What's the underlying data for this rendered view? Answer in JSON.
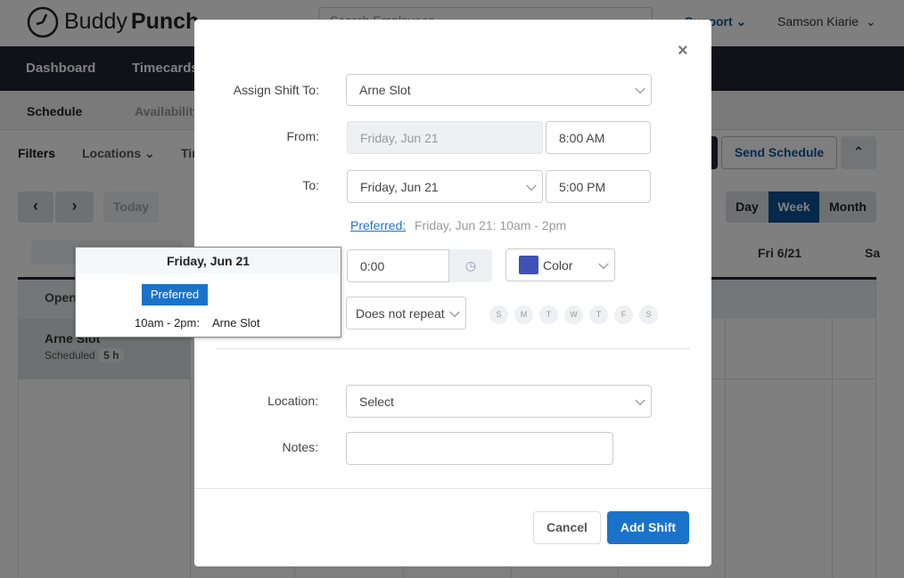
{
  "header": {
    "brand_light": "Buddy",
    "brand_bold": "Punch",
    "search_placeholder": "Search Employees",
    "support": "Support",
    "user": "Samson Kiarie"
  },
  "nav": {
    "items": [
      "Dashboard",
      "Timecards"
    ]
  },
  "subnav": {
    "items": [
      "Schedule",
      "Availability"
    ]
  },
  "toolbar": {
    "filters": "Filters",
    "locations": "Locations",
    "times": "Times",
    "send_schedule": "Send Schedule",
    "today": "Today",
    "views": [
      "Day",
      "Week",
      "Month"
    ],
    "active_view": "Week"
  },
  "calendar": {
    "day_headers": [
      "Fri 6/21",
      "Sa"
    ],
    "open_shifts": "Open Shifts",
    "employee": "Arne Slot",
    "scheduled_label": "Scheduled",
    "scheduled_hours": "5 h"
  },
  "tooltip": {
    "date": "Friday, Jun 21",
    "badge": "Preferred",
    "time": "10am - 2pm:",
    "name": "Arne Slot"
  },
  "modal": {
    "assign_label": "Assign Shift To:",
    "assign_value": "Arne Slot",
    "from_label": "From:",
    "from_date": "Friday, Jun 21",
    "from_time": "8:00 AM",
    "to_label": "To:",
    "to_date": "Friday, Jun 21",
    "to_time": "5:00 PM",
    "preferred_link": "Preferred:",
    "preferred_text": "Friday, Jun 21: 10am - 2pm",
    "break_value": "0:00",
    "color_label": "Color",
    "color": "#3f51b5",
    "repeat_value": "Does not repeat",
    "days": [
      "S",
      "M",
      "T",
      "W",
      "T",
      "F",
      "S"
    ],
    "location_label": "Location:",
    "location_value": "Select",
    "notes_label": "Notes:",
    "notes_value": "",
    "cancel": "Cancel",
    "add_shift": "Add Shift"
  },
  "colors": {
    "primary": "#1a73c8",
    "nav": "#1f2430",
    "active_view": "#0b5394"
  }
}
